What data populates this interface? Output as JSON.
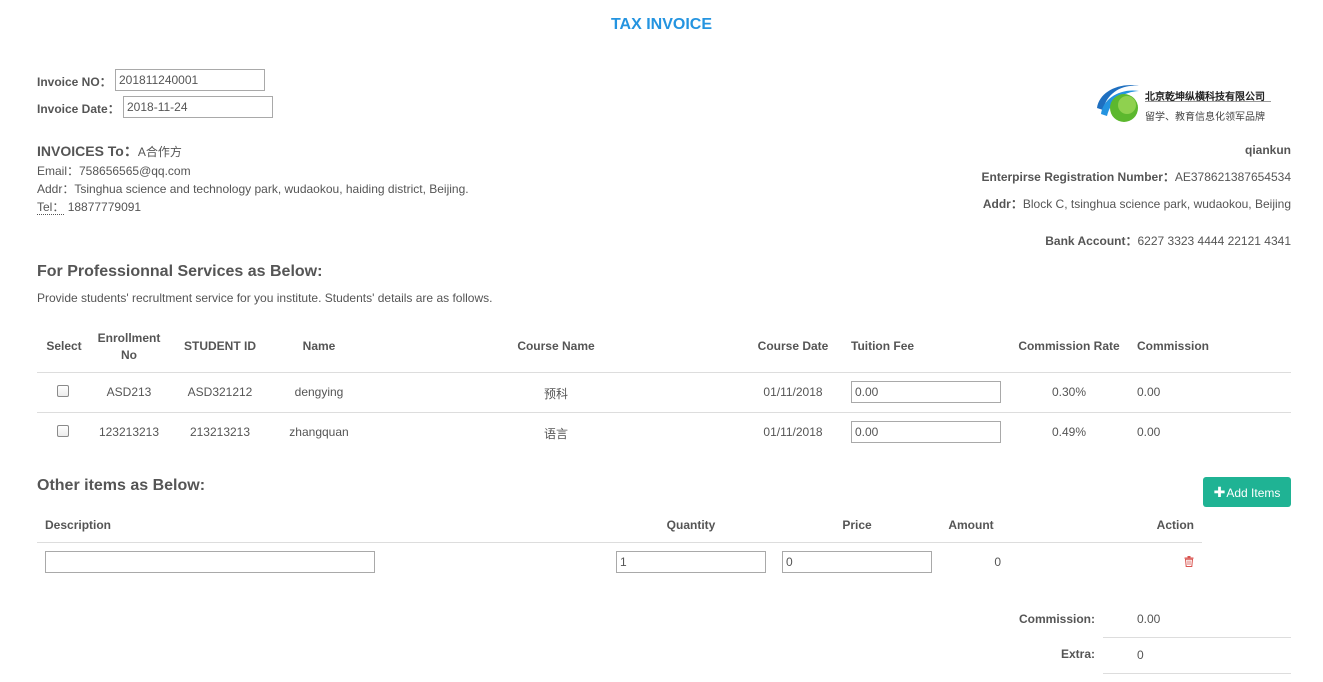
{
  "title": "TAX INVOICE",
  "invoice": {
    "no_label": "Invoice NO：",
    "no_value": "201811240001",
    "date_label": "Invoice Date：",
    "date_value": "2018-11-24"
  },
  "logo": {
    "company_cn": "北京乾坤纵横科技有限公司",
    "slogan_cn": "留学、教育信息化领军品牌"
  },
  "to": {
    "label": "INVOICES To：",
    "name": "A合作方",
    "email": "Email：758656565@qq.com",
    "addr": "Addr：Tsinghua science and technology park, wudaokou, haiding district, Beijing.",
    "tel_label": "Tel：",
    "tel_value": "18877779091"
  },
  "from": {
    "name": "qiankun",
    "reg_label": "Enterpirse Registration Number：",
    "reg_value": "AE378621387654534",
    "addr_label": "Addr：",
    "addr_value": "Block C, tsinghua science park, wudaokou, Beijing",
    "bank_label": "Bank Account：",
    "bank_value": "6227 3323 4444 22121 4341"
  },
  "services": {
    "heading": "For Professionnal Services as Below:",
    "description": "Provide students' recrultment service for you institute. Students' details are as follows.",
    "headers": {
      "select": "Select",
      "enroll1": "Enrollment",
      "enroll2": "No",
      "student_id": "STUDENT ID",
      "name": "Name",
      "course": "Course Name",
      "date": "Course Date",
      "fee": "Tuition Fee",
      "rate": "Commission Rate",
      "commission": "Commission"
    },
    "rows": [
      {
        "enroll": "ASD213",
        "student_id": "ASD321212",
        "name": "dengying",
        "course": "预科",
        "date": "01/11/2018",
        "fee": "0.00",
        "rate": "0.30%",
        "commission": "0.00"
      },
      {
        "enroll": "123213213",
        "student_id": "213213213",
        "name": "zhangquan",
        "course": "语言",
        "date": "01/11/2018",
        "fee": "0.00",
        "rate": "0.49%",
        "commission": "0.00"
      }
    ]
  },
  "other": {
    "heading": "Other items as Below:",
    "add_button": "Add Items",
    "headers": {
      "description": "Description",
      "quantity": "Quantity",
      "price": "Price",
      "amount": "Amount",
      "action": "Action"
    },
    "row": {
      "description": "",
      "quantity": "1",
      "price": "0",
      "amount": "0"
    }
  },
  "totals": {
    "commission_label": "Commission:",
    "commission_value": "0.00",
    "extra_label": "Extra:",
    "extra_value": "0"
  },
  "colors": {
    "accent": "#2494e0",
    "button": "#1fb394",
    "delete": "#d9534f"
  }
}
